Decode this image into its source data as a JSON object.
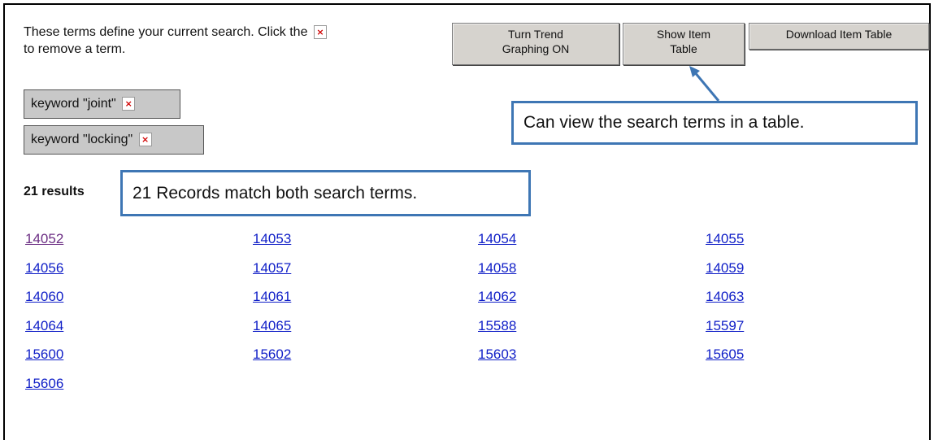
{
  "instructions": {
    "text_before": "These terms define your current search. Click the",
    "text_after": "to remove a term.",
    "remove_symbol": "×"
  },
  "buttons": {
    "trend_line1": "Turn Trend",
    "trend_line2": "Graphing ON",
    "show_line1": "Show Item",
    "show_line2": "Table",
    "download": "Download Item Table"
  },
  "terms": [
    {
      "label": "keyword \"joint\""
    },
    {
      "label": "keyword \"locking\""
    }
  ],
  "callouts": {
    "table": "Can view the search terms in a table.",
    "records": "21 Records match both search terms."
  },
  "results": {
    "count_label": "21 results",
    "items": [
      "14052",
      "14053",
      "14054",
      "14055",
      "14056",
      "14057",
      "14058",
      "14059",
      "14060",
      "14061",
      "14062",
      "14063",
      "14064",
      "14065",
      "15588",
      "15597",
      "15600",
      "15602",
      "15603",
      "15605",
      "15606"
    ]
  },
  "colors": {
    "link": "#0f1ec7",
    "link_visited": "#6b2d83",
    "callout_border": "#3e76b4",
    "remove_x": "#d00000"
  }
}
